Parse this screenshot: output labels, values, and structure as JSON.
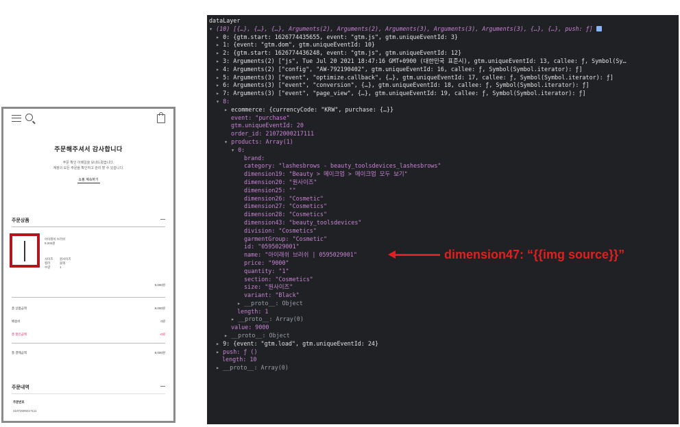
{
  "phone": {
    "title": "주문해주셔서 감사합니다",
    "message_lines": [
      "주문 확인 이메일을 보내드렸습니다.",
      "계정의 모든 주문을 확인하고 관리 할 수 있습니다."
    ],
    "shop_link": "쇼핑 계속하기",
    "product_section": "주문상품",
    "product": {
      "name": "아이래쉬 브러쉬",
      "price": "9,000원",
      "size_label": "사이즈",
      "size_value": "원사이즈",
      "color_label": "컬러",
      "color_value": "블랙",
      "qty_label": "수량",
      "qty_value": "1",
      "line_total": "9,000원"
    },
    "summary": {
      "subtotal_label": "총 상품금액",
      "subtotal_value": "9,000원",
      "shipping_label": "배송비",
      "shipping_value": "0원",
      "discount_label": "총 할인금액",
      "discount_value": "-0원",
      "total_label": "총 결제금액",
      "total_value": "9,000원"
    },
    "order_section": "주문내역",
    "order_no_label": "주문번호",
    "order_no_value": "21072000217111"
  },
  "console": {
    "header": "dataLayer",
    "summary": "(10) [{…}, {…}, {…}, Arguments(2), Arguments(2), Arguments(3), Arguments(3), Arguments(3), {…}, {…}, push: ƒ]",
    "lines": [
      "0: {gtm.start: 1626774435655, event: \"gtm.js\", gtm.uniqueEventId: 3}",
      "1: {event: \"gtm.dom\", gtm.uniqueEventId: 10}",
      "2: {gtm.start: 1626774436248, event: \"gtm.js\", gtm.uniqueEventId: 12}",
      "3: Arguments(2) [\"js\", Tue Jul 20 2021 18:47:16 GMT+0900 (대한민국 표준시), gtm.uniqueEventId: 13, callee: ƒ, Symbol(Sy…",
      "4: Arguments(2) [\"config\", \"AW-792190402\", gtm.uniqueEventId: 16, callee: ƒ, Symbol(Symbol.iterator): ƒ]",
      "5: Arguments(3) [\"event\", \"optimize.callback\", {…}, gtm.uniqueEventId: 17, callee: ƒ, Symbol(Symbol.iterator): ƒ]",
      "6: Arguments(3) [\"event\", \"conversion\", {…}, gtm.uniqueEventId: 18, callee: ƒ, Symbol(Symbol.iterator): ƒ]",
      "7: Arguments(3) [\"event\", \"page_view\", {…}, gtm.uniqueEventId: 19, callee: ƒ, Symbol(Symbol.iterator): ƒ]"
    ],
    "item8": "8:",
    "ecommerce": "ecommerce: {currencyCode: \"KRW\", purchase: {…}}",
    "event": "event: \"purchase\"",
    "gtm_id": "gtm.uniqueEventId: 20",
    "order_id": "order_id: 21072000217111",
    "products": "products: Array(1)",
    "p0": "0:",
    "fields": [
      "brand:",
      "category: \"lashesbrows - beauty_toolsdevices_lashesbrows\"",
      "dimension19: \"Beauty > 메이크업 > 메이크업 모두 보기\"",
      "dimension20: \"원사이즈\"",
      "dimension25: \"\"",
      "dimension26: \"Cosmetic\"",
      "dimension27: \"Cosmetics\"",
      "dimension28: \"Cosmetics\"",
      "dimension43: \"beauty_toolsdevices\"",
      "division: \"Cosmetics\"",
      "garmentGroup: \"Cosmetic\"",
      "id: \"0595029001\"",
      "name: \"아이래쉬 브러쉬 | 0595029001\"",
      "price: \"9000\"",
      "quantity: \"1\"",
      "section: \"Cosmetics\"",
      "size: \"원사이즈\"",
      "variant: \"Black\""
    ],
    "proto_obj": "__proto__: Object",
    "length1": "length: 1",
    "proto_arr": "__proto__: Array(0)",
    "value": "value: 9000",
    "proto_obj2": "__proto__: Object",
    "item9": "9: {event: \"gtm.load\", gtm.uniqueEventId: 24}",
    "push": "push: ƒ ()",
    "length10": "length: 10",
    "proto_arr2": "__proto__: Array(0)"
  },
  "annotation": "dimension47: “{{img source}}”",
  "colors": {
    "annotation": "#e02020",
    "highlight_box": "#b0161e",
    "console_bg": "#202124",
    "discount": "#e0206a"
  }
}
